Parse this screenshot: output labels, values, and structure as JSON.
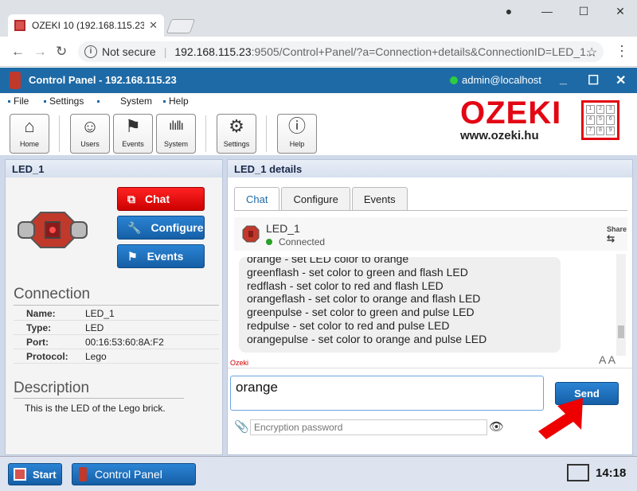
{
  "browser": {
    "tab_title": "OZEKI 10 (192.168.115.23",
    "security": "Not secure",
    "url_host": "192.168.115.23",
    "url_path": ":9505/Control+Panel/?a=Connection+details&ConnectionID=LED_1..."
  },
  "app": {
    "title": "Control Panel - 192.168.115.23",
    "user": "admin@localhost"
  },
  "menu": [
    "File",
    "Settings",
    "System",
    "Help"
  ],
  "toolbar": [
    {
      "label": "Home",
      "icon": "home-icon"
    },
    {
      "label": "Users",
      "icon": "user-icon"
    },
    {
      "label": "Events",
      "icon": "flag-icon"
    },
    {
      "label": "System",
      "icon": "bars-icon"
    },
    {
      "label": "Settings",
      "icon": "gear-icon"
    },
    {
      "label": "Help",
      "icon": "info-icon"
    }
  ],
  "brand": {
    "name": "OZEKI",
    "url": "www.ozeki.hu",
    "grid": [
      "1",
      "2",
      "3",
      "4",
      "5",
      "6",
      "7",
      "8",
      "9"
    ]
  },
  "left": {
    "header": "LED_1",
    "buttons": {
      "chat": "Chat",
      "configure": "Configure",
      "events": "Events"
    },
    "connection_title": "Connection",
    "fields": [
      {
        "k": "Name:",
        "v": "LED_1"
      },
      {
        "k": "Type:",
        "v": "LED"
      },
      {
        "k": "Port:",
        "v": "00:16:53:60:8A:F2"
      },
      {
        "k": "Protocol:",
        "v": "Lego"
      }
    ],
    "description_title": "Description",
    "description": "This is the LED of the Lego brick."
  },
  "right": {
    "header": "LED_1 details",
    "tabs": [
      "Chat",
      "Configure",
      "Events"
    ],
    "contact_name": "LED_1",
    "contact_status": "Connected",
    "share": "Share",
    "messages": [
      "orange - set LED color to orange",
      "greenflash - set color to green and flash LED",
      "redflash - set color to red and flash LED",
      "orangeflash - set color to orange and flash LED",
      "greenpulse - set color to green and pulse LED",
      "redpulse - set color to red and pulse LED",
      "orangepulse - set color to orange and pulse LED"
    ],
    "sender_label": "Ozeki",
    "font_toggle": "A A",
    "input_value": "orange",
    "send_label": "Send",
    "password_placeholder": "Encryption password"
  },
  "taskbar": {
    "start": "Start",
    "app": "Control Panel",
    "time": "14:18"
  }
}
